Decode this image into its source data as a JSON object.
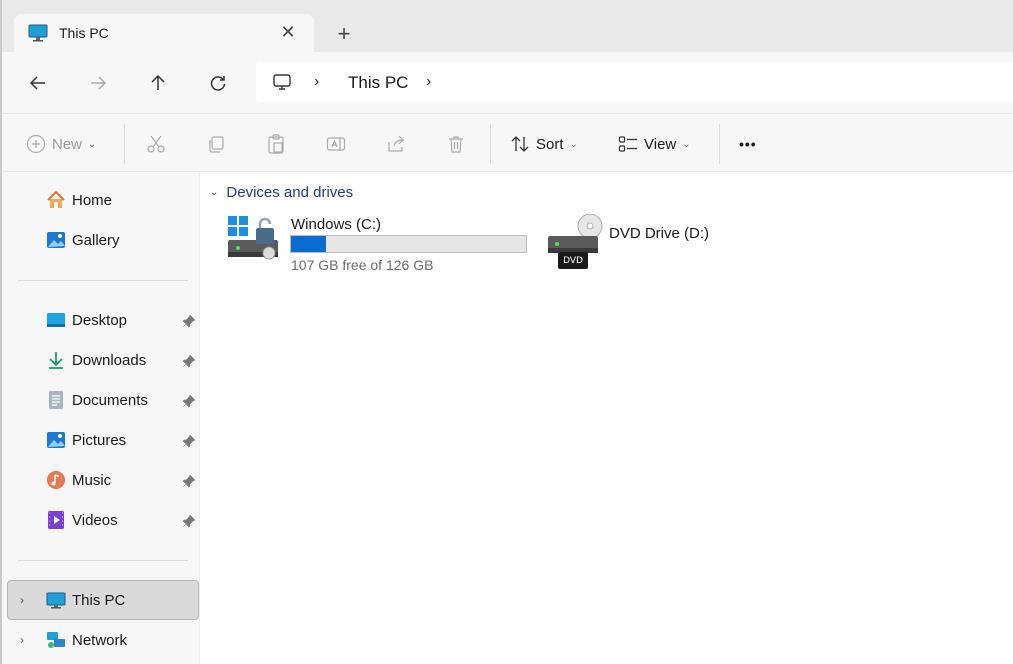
{
  "window": {
    "tab_title": "This PC",
    "tab_icon": "monitor-icon",
    "close_glyph": "✕",
    "new_tab_glyph": "+"
  },
  "nav": {
    "back_icon": "arrow-left-icon",
    "forward_icon": "arrow-right-icon",
    "up_icon": "arrow-up-icon",
    "refresh_icon": "refresh-icon",
    "breadcrumb": [
      "This PC"
    ]
  },
  "command_bar": {
    "new_label": "New",
    "sort_label": "Sort",
    "view_label": "View",
    "more_glyph": "•••"
  },
  "sidebar": {
    "quick": [
      {
        "label": "Home",
        "icon": "home-icon"
      },
      {
        "label": "Gallery",
        "icon": "gallery-icon"
      }
    ],
    "pinned": [
      {
        "label": "Desktop",
        "icon": "desktop-folder-icon"
      },
      {
        "label": "Downloads",
        "icon": "downloads-icon"
      },
      {
        "label": "Documents",
        "icon": "documents-icon"
      },
      {
        "label": "Pictures",
        "icon": "pictures-icon"
      },
      {
        "label": "Music",
        "icon": "music-icon"
      },
      {
        "label": "Videos",
        "icon": "videos-icon"
      }
    ],
    "locations": [
      {
        "label": "This PC",
        "icon": "this-pc-icon",
        "selected": true
      },
      {
        "label": "Network",
        "icon": "network-icon",
        "selected": false
      }
    ]
  },
  "content": {
    "group_title": "Devices and drives",
    "drives": [
      {
        "name": "Windows (C:)",
        "free_text": "107 GB free of 126 GB",
        "used_fraction": 0.15,
        "icon": "windows-drive-icon"
      },
      {
        "name": "DVD Drive (D:)",
        "icon": "dvd-drive-icon",
        "badge": "DVD"
      }
    ]
  },
  "colors": {
    "accent": "#0a6cd0",
    "group_header": "#1f3a8a",
    "selected_bg": "#dadada"
  }
}
